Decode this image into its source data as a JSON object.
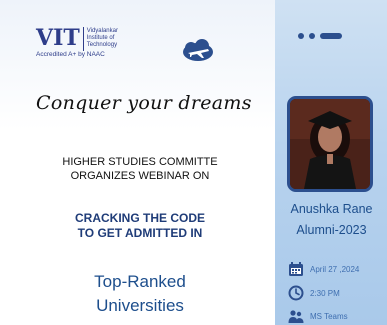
{
  "logo": {
    "mark": "VIT",
    "name_lines": [
      "Vidyalankar",
      "Institute of",
      "Technology"
    ],
    "accreditation": "Accredited A+ by NAAC"
  },
  "icons": {
    "plane": "airplane-cloud-icon",
    "date": "calendar-icon",
    "time": "clock-icon",
    "platform": "people-icon"
  },
  "headline": "Conquer your dreams",
  "organizer_lines": [
    "HIGHER STUDIES COMMITTE",
    "ORGANIZES WEBINAR ON"
  ],
  "topic_lines": [
    "CRACKING THE CODE",
    "TO GET ADMITTED IN"
  ],
  "highlight_lines": [
    "Top-Ranked",
    "Universities"
  ],
  "speaker": {
    "name": "Anushka Rane",
    "batch": "Alumni-2023"
  },
  "event": {
    "date": "April 27 ,2024",
    "time": "2:30 PM",
    "platform": "MS Teams"
  },
  "colors": {
    "brand_navy": "#2c4f8e",
    "accent_blue": "#1d4e8c",
    "strip_blue": "#b8d3ee"
  }
}
